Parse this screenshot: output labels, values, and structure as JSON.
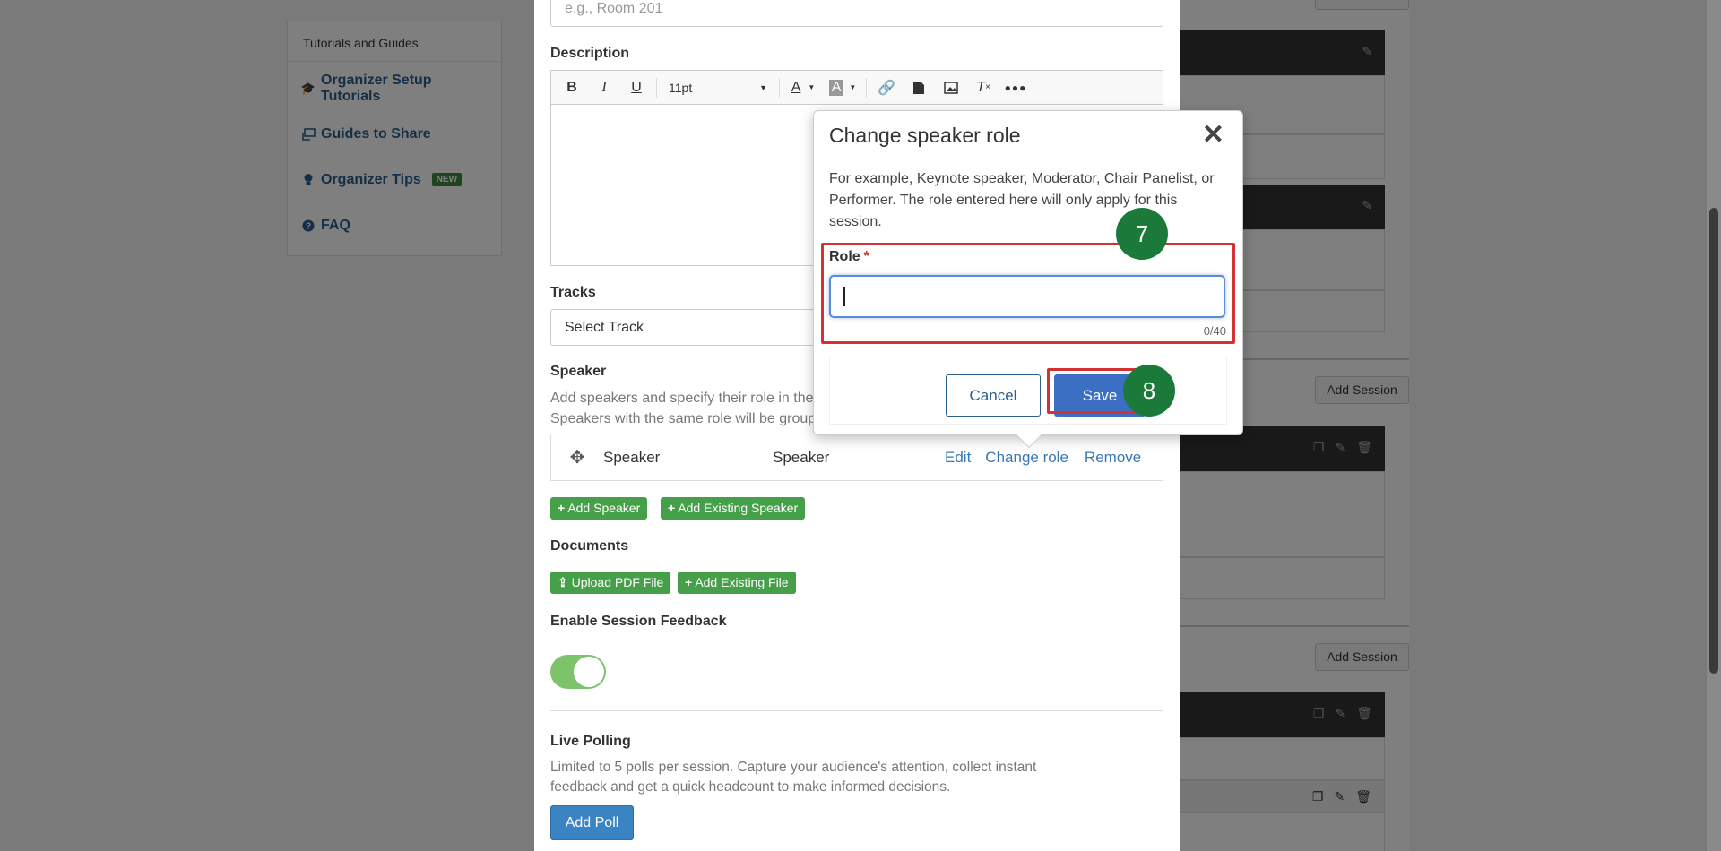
{
  "sidebar": {
    "heading": "Tutorials and Guides",
    "items": [
      {
        "label": "Organizer Setup Tutorials",
        "icon": "graduation-cap-icon"
      },
      {
        "label": "Guides to Share",
        "icon": "share-screen-icon"
      },
      {
        "label": "Organizer Tips",
        "icon": "lightbulb-icon",
        "badge": "NEW"
      },
      {
        "label": "FAQ",
        "icon": "question-circle-icon"
      }
    ]
  },
  "session_form": {
    "room_placeholder": "e.g., Room 201",
    "description_label": "Description",
    "editor_font_size": "11pt",
    "tracks_label": "Tracks",
    "tracks_value": "Select Track",
    "speaker_label": "Speaker",
    "speaker_help": "Add speakers and specify their role in the s",
    "speaker_help_2": "Speakers with the same role will be groupe",
    "speaker_row": {
      "name": "Speaker",
      "role": "Speaker",
      "edit": "Edit",
      "change_role": "Change role",
      "remove": "Remove"
    },
    "add_speaker": "Add Speaker",
    "add_existing_speaker": "Add Existing Speaker",
    "documents_label": "Documents",
    "upload_pdf": "Upload PDF File",
    "add_existing_file": "Add Existing File",
    "feedback_label": "Enable Session Feedback",
    "feedback_enabled": true,
    "live_polling_label": "Live Polling",
    "live_polling_help": "Limited to 5 polls per session. Capture your audience's attention, collect instant feedback and get a quick headcount to make informed decisions.",
    "add_poll": "Add Poll"
  },
  "right_panel": {
    "add_session": "Add Session"
  },
  "role_dialog": {
    "title": "Change speaker role",
    "close": "✕",
    "description": "For example, Keynote speaker, Moderator, Chair Panelist, or Performer. The role entered here will only apply for this session.",
    "role_label": "Role",
    "required_mark": "*",
    "role_value": "",
    "char_count": "0/40",
    "cancel": "Cancel",
    "save": "Save"
  },
  "step_badges": {
    "role_step": "7",
    "save_step": "8"
  },
  "colors": {
    "highlight": "#d43232",
    "badge": "#1b7a3a",
    "primary": "#3a6fc4",
    "success": "#45a049"
  }
}
